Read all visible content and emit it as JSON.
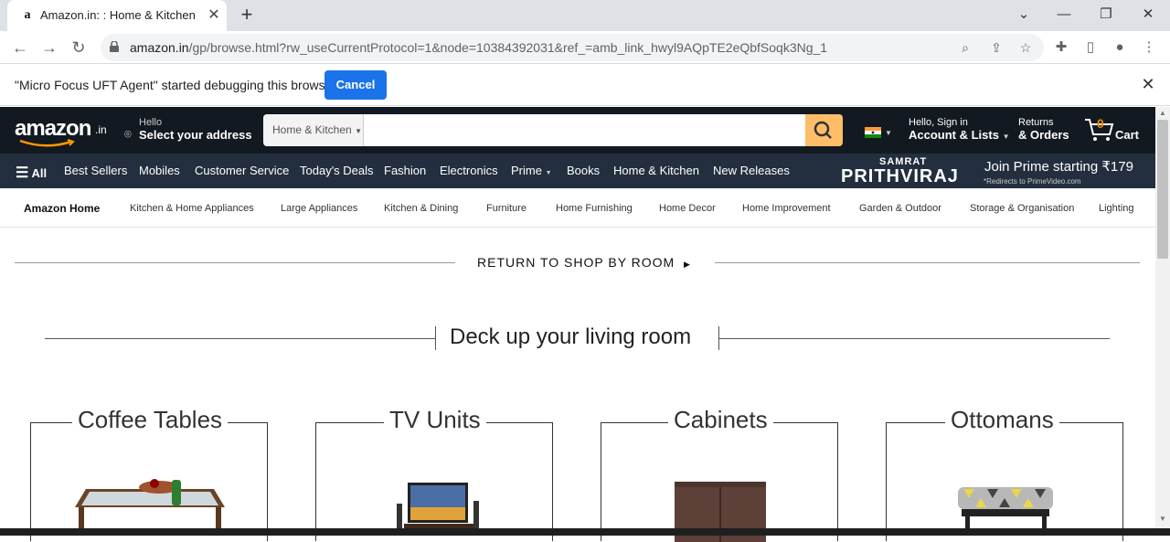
{
  "browser": {
    "tab_title": "Amazon.in: : Home & Kitchen",
    "favicon_letter": "a",
    "url_host": "amazon.in",
    "url_path": "/gp/browse.html?rw_useCurrentProtocol=1&node=10384392031&ref_=amb_link_hwyl9AQpTE2eQbfSoqk3Ng_1"
  },
  "infobar": {
    "message": "\"Micro Focus UFT Agent\" started debugging this browser",
    "cancel_label": "Cancel"
  },
  "header": {
    "logo_text": "amazon",
    "logo_suffix": ".in",
    "hello": "Hello",
    "address": "Select your address",
    "search_category": "Home & Kitchen",
    "search_placeholder": "",
    "account_small": "Hello, Sign in",
    "account_big": "Account & Lists",
    "returns_small": "Returns",
    "returns_big": "& Orders",
    "cart_count": "0",
    "cart_label": "Cart"
  },
  "nav": {
    "all": "All",
    "items": [
      "Best Sellers",
      "Mobiles",
      "Customer Service",
      "Today's Deals",
      "Fashion",
      "Electronics",
      "Prime",
      "Books",
      "Home & Kitchen",
      "New Releases"
    ],
    "promo_small": "SAMRAT",
    "promo_title": "PRITHVIRAJ",
    "promo_join": "Join Prime starting ₹179",
    "promo_redirect": "*Redirects to PrimeVideo.com"
  },
  "subnav": {
    "items": [
      "Amazon Home",
      "Kitchen & Home Appliances",
      "Large Appliances",
      "Kitchen & Dining",
      "Furniture",
      "Home Furnishing",
      "Home Decor",
      "Home Improvement",
      "Garden & Outdoor",
      "Storage & Organisation",
      "Lighting"
    ]
  },
  "content": {
    "return_link": "RETURN TO SHOP BY ROOM",
    "section_title": "Deck up your living room",
    "cards": [
      "Coffee Tables",
      "TV Units",
      "Cabinets",
      "Ottomans"
    ]
  },
  "colors": {
    "header_bg": "#131921",
    "nav_bg": "#232f3e",
    "search_button": "#febd69",
    "cart_count": "#f08804",
    "infobar_button": "#1a73e8"
  }
}
